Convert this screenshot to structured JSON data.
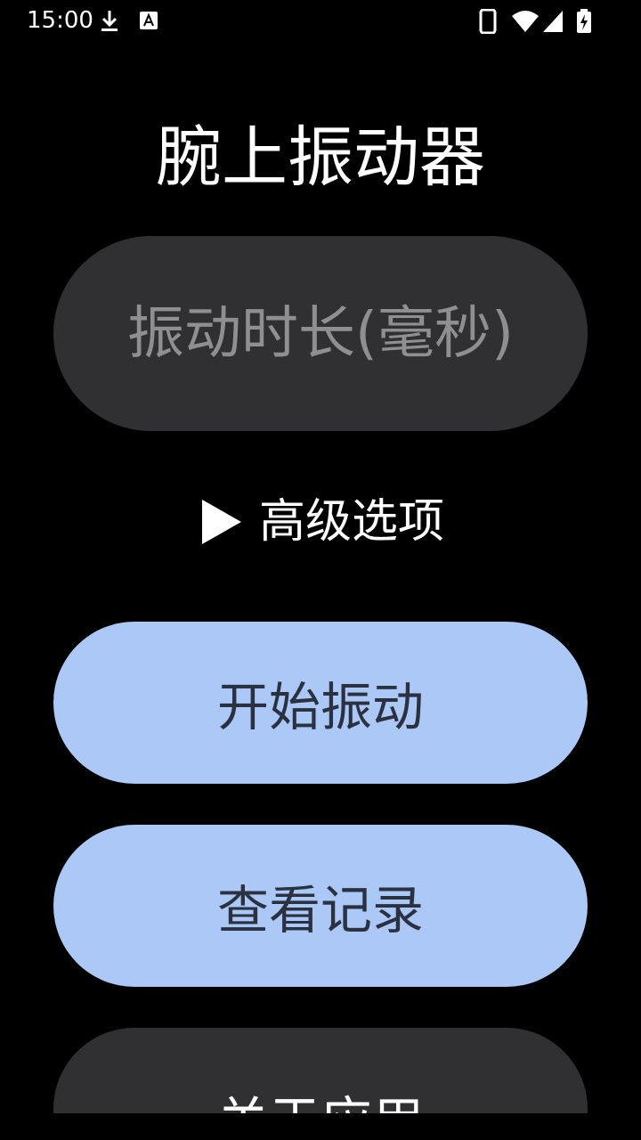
{
  "status_bar": {
    "time": "15:00",
    "icons": [
      "download-icon",
      "a-notification-icon",
      "phone-icon",
      "wifi-icon",
      "signal-icon",
      "battery-charging-icon"
    ]
  },
  "app": {
    "title": "腕上振动器"
  },
  "input": {
    "placeholder": "振动时长(毫秒)",
    "value": ""
  },
  "advanced": {
    "label": "高级选项",
    "expanded": false
  },
  "buttons": {
    "start": "开始振动",
    "records": "查看记录",
    "about": "关于应用"
  },
  "colors": {
    "background": "#000000",
    "primary_button": "#abc8f6",
    "primary_button_text": "#2a3140",
    "surface": "#303032",
    "placeholder": "#8f8f92"
  }
}
